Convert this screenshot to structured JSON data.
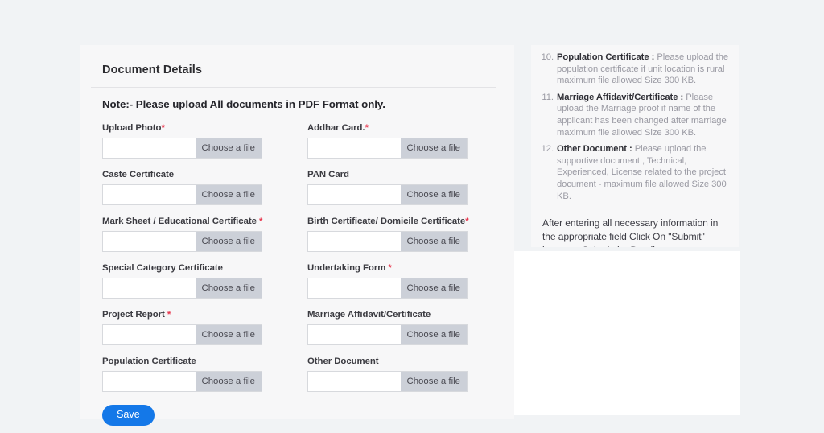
{
  "theme": {
    "page_background": "#f1f3f5",
    "card_background": "#f7f7f8",
    "accent": "#1478e8",
    "required_marker_color": "#e8384f",
    "file_button_background": "#ccd0d8"
  },
  "form": {
    "title": "Document Details",
    "note": "Note:- Please upload All documents in PDF Format only.",
    "file_button_label": "Choose a file",
    "file_input_placeholder": "",
    "save_label": "Save",
    "fields": [
      {
        "label": "Upload Photo",
        "required": true,
        "marker": "*",
        "value": ""
      },
      {
        "label": "Addhar Card.",
        "required": true,
        "marker": "*",
        "value": ""
      },
      {
        "label": "Caste Certificate",
        "required": false,
        "marker": "",
        "value": ""
      },
      {
        "label": "PAN Card",
        "required": false,
        "marker": "",
        "value": ""
      },
      {
        "label": "Mark Sheet / Educational Certificate ",
        "required": true,
        "marker": "*",
        "value": ""
      },
      {
        "label": "Birth Certificate/ Domicile Certificate",
        "required": true,
        "marker": "*",
        "value": ""
      },
      {
        "label": "Special Category Certificate",
        "required": false,
        "marker": "",
        "value": ""
      },
      {
        "label": "Undertaking Form ",
        "required": true,
        "marker": "*",
        "value": ""
      },
      {
        "label": "Project Report ",
        "required": true,
        "marker": "*",
        "value": ""
      },
      {
        "label": "Marriage Affidavit/Certificate",
        "required": false,
        "marker": "",
        "value": ""
      },
      {
        "label": "Population Certificate",
        "required": false,
        "marker": "",
        "value": ""
      },
      {
        "label": "Other Document",
        "required": false,
        "marker": "",
        "value": ""
      }
    ]
  },
  "instructions": {
    "items": [
      {
        "number": "10.",
        "term": "Population Certificate :",
        "text": " Please upload the population certificate if unit location is rural maximum file allowed Size 300 KB."
      },
      {
        "number": "11.",
        "term": "Marriage Affidavit/Certificate :",
        "text": " Please upload the Marriage proof if name of the applicant has been changed after marriage maximum file allowed Size 300 KB."
      },
      {
        "number": "12.",
        "term": "Other Document :",
        "text": " Please upload the supportive document , Technical, Experienced, License related to the project document - maximum file allowed Size 300 KB."
      }
    ],
    "footer": "After entering all necessary information in the appropriate field Click On \"Submit\" button to Submit the Details.."
  }
}
